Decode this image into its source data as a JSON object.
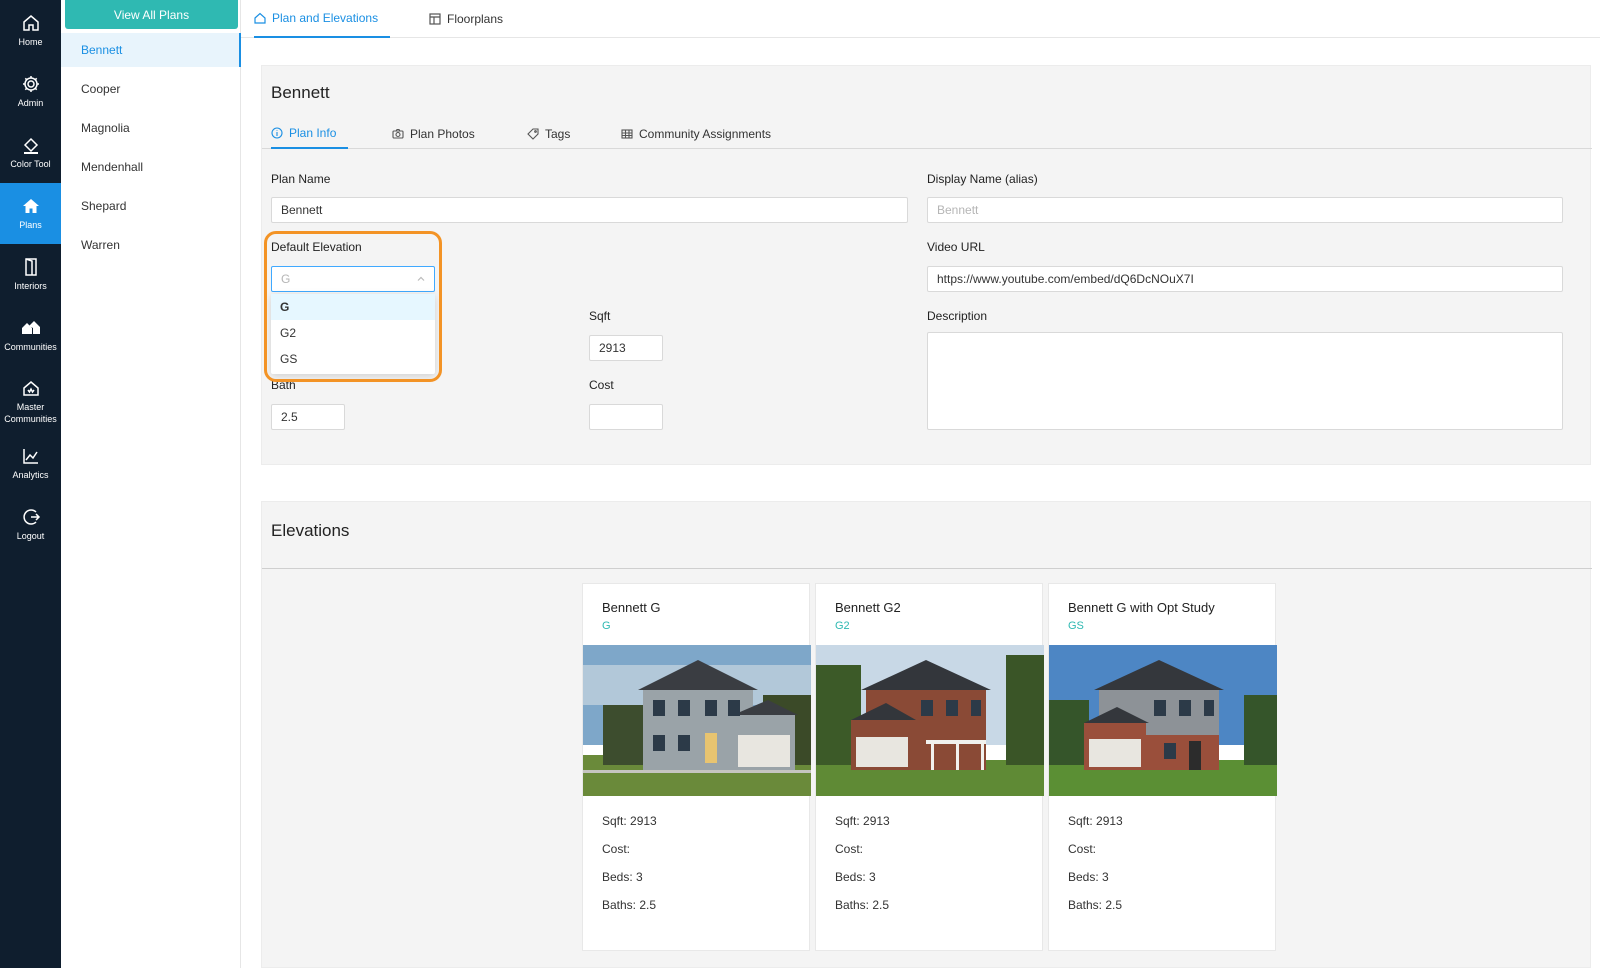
{
  "rail": {
    "items": [
      {
        "label": "Home",
        "icon": "home-icon"
      },
      {
        "label": "Admin",
        "icon": "gear-icon"
      },
      {
        "label": "Color Tool",
        "icon": "paint-bucket-icon"
      },
      {
        "label": "Plans",
        "icon": "house-icon"
      },
      {
        "label": "Interiors",
        "icon": "door-icon"
      },
      {
        "label": "Communities",
        "icon": "houses-icon"
      },
      {
        "label": "Master Communities",
        "icon": "crown-house-icon"
      },
      {
        "label": "Analytics",
        "icon": "line-chart-icon"
      },
      {
        "label": "Logout",
        "icon": "logout-icon"
      }
    ],
    "active": "Plans",
    "active_color": "#1a8fe3"
  },
  "planlist": {
    "view_all_label": "View All Plans",
    "items": [
      "Bennett",
      "Cooper",
      "Magnolia",
      "Mendenhall",
      "Shepard",
      "Warren"
    ],
    "active": "Bennett"
  },
  "toptabs": {
    "tabs": [
      {
        "label": "Plan and Elevations",
        "icon": "home-icon"
      },
      {
        "label": "Floorplans",
        "icon": "floorplan-icon"
      }
    ],
    "active": "Plan and Elevations"
  },
  "plan": {
    "title": "Bennett",
    "subtabs": [
      {
        "label": "Plan Info",
        "icon": "info-icon"
      },
      {
        "label": "Plan Photos",
        "icon": "camera-icon"
      },
      {
        "label": "Tags",
        "icon": "tag-icon"
      },
      {
        "label": "Community Assignments",
        "icon": "table-icon"
      }
    ],
    "active_subtab": "Plan Info",
    "fields": {
      "plan_name_label": "Plan Name",
      "plan_name_value": "Bennett",
      "display_name_label": "Display Name (alias)",
      "display_name_placeholder": "Bennett",
      "default_elevation_label": "Default Elevation",
      "default_elevation_placeholder": "G",
      "video_url_label": "Video URL",
      "video_url_value": "https://www.youtube.com/embed/dQ6DcNOuX7I",
      "sqft_label": "Sqft",
      "sqft_value": "2913",
      "description_label": "Description",
      "bath_label": "Bath",
      "bath_value": "2.5",
      "cost_label": "Cost",
      "cost_value": ""
    },
    "dropdown_options": [
      "G",
      "G2",
      "GS"
    ],
    "dropdown_selected": "G",
    "highlight_color": "#f39325"
  },
  "elevations": {
    "title": "Elevations",
    "cards": [
      {
        "name": "Bennett G",
        "code": "G",
        "sqft": "Sqft: 2913",
        "cost": "Cost:",
        "beds": "Beds: 3",
        "baths": "Baths: 2.5",
        "siding": "#9aa3a8",
        "sky": "#7ea7c9"
      },
      {
        "name": "Bennett G2",
        "code": "G2",
        "sqft": "Sqft: 2913",
        "cost": "Cost:",
        "beds": "Beds: 3",
        "baths": "Baths: 2.5",
        "siding": "#8a4a36",
        "sky": "#c8d8e6"
      },
      {
        "name": "Bennett G with Opt Study",
        "code": "GS",
        "sqft": "Sqft: 2913",
        "cost": "Cost:",
        "beds": "Beds: 3",
        "baths": "Baths: 2.5",
        "siding": "#8d9297",
        "sky": "#4d86c4"
      }
    ]
  }
}
